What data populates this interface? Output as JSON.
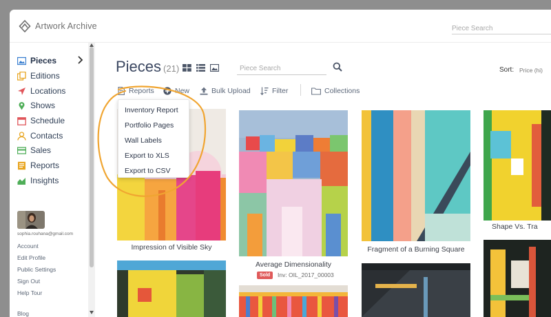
{
  "app": {
    "name": "Artwork Archive",
    "search_placeholder": "Piece Search"
  },
  "sidebar": {
    "items": [
      {
        "label": "Pieces",
        "icon": "image-icon",
        "active": true,
        "color": "#3a7fd0"
      },
      {
        "label": "Editions",
        "icon": "editions-icon",
        "color": "#e8a520"
      },
      {
        "label": "Locations",
        "icon": "location-arrow-icon",
        "color": "#e0555a"
      },
      {
        "label": "Shows",
        "icon": "map-pin-icon",
        "color": "#4fae58"
      },
      {
        "label": "Schedule",
        "icon": "calendar-icon",
        "color": "#e0555a"
      },
      {
        "label": "Contacts",
        "icon": "contact-icon",
        "color": "#e8a520"
      },
      {
        "label": "Sales",
        "icon": "credit-card-icon",
        "color": "#4fae58"
      },
      {
        "label": "Reports",
        "icon": "report-icon",
        "color": "#e8a520"
      },
      {
        "label": "Insights",
        "icon": "chart-icon",
        "color": "#4fae58"
      }
    ],
    "user_email": "sophia.rouhana@gmail.com",
    "links": [
      "Account",
      "Edit Profile",
      "Public Settings",
      "Sign Out",
      "Help Tour",
      "Blog"
    ]
  },
  "main": {
    "title": "Pieces",
    "count": "(21)",
    "search_placeholder": "Piece Search",
    "sort_label": "Sort:",
    "sort_value": "Price (hi)",
    "toolbar": {
      "reports": "Reports",
      "new": "New",
      "bulk_upload": "Bulk Upload",
      "filter": "Filter",
      "collections": "Collections"
    },
    "reports_menu": [
      "Inventory Report",
      "Portfolio Pages",
      "Wall Labels",
      "Export to XLS",
      "Export to CSV"
    ],
    "pieces": [
      {
        "title": "Impression of Visible Sky"
      },
      {
        "title": "Average Dimensionality",
        "status": "Sold",
        "inventory": "Inv: OIL_2017_00003"
      },
      {
        "title": "Fragment of a Burning Square"
      },
      {
        "title": "Shape Vs. Tra"
      }
    ]
  },
  "colors": {
    "accent_highlight": "#f0a531",
    "nav_text": "#2f3f56",
    "sold": "#e05a5a"
  }
}
